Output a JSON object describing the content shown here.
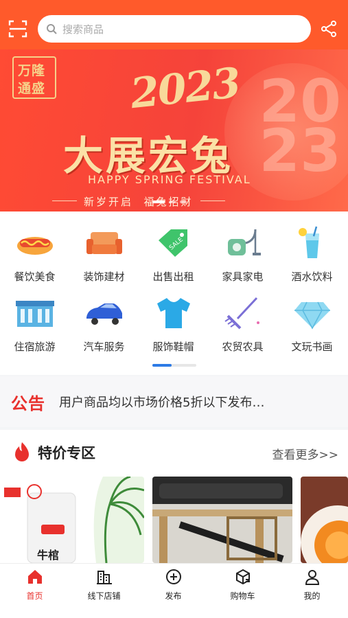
{
  "header": {
    "search_placeholder": "搜索商品",
    "scan_icon": "scan-icon",
    "share_icon": "share-icon",
    "bar_color": "#ff5a2b"
  },
  "banner": {
    "logo_line1": "万隆",
    "logo_line2": "通盛",
    "year": "2023",
    "headline": "大展宏兔",
    "english": "HAPPY SPRING FESTIVAL",
    "subline": "新岁开启  福兔招财",
    "deco_digits": "20\n23",
    "slide_count": 3,
    "active_slide": 1
  },
  "categories": [
    {
      "label": "餐饮美食",
      "icon": "hotdog-icon"
    },
    {
      "label": "装饰建材",
      "icon": "sofa-icon"
    },
    {
      "label": "出售出租",
      "icon": "sale-tag-icon"
    },
    {
      "label": "家具家电",
      "icon": "vacuum-icon"
    },
    {
      "label": "酒水饮料",
      "icon": "drink-icon"
    },
    {
      "label": "住宿旅游",
      "icon": "hotel-icon"
    },
    {
      "label": "汽车服务",
      "icon": "car-icon"
    },
    {
      "label": "服饰鞋帽",
      "icon": "shirt-icon"
    },
    {
      "label": "农贸农具",
      "icon": "rake-icon"
    },
    {
      "label": "文玩书画",
      "icon": "diamond-icon"
    }
  ],
  "notice": {
    "tag": "公告",
    "text": "用户商品均以市场价格5折以下发布…"
  },
  "special": {
    "title": "特价专区",
    "more": "查看更多>>",
    "products": [
      {
        "name": "milk-product-image",
        "visible_text": "牛棺"
      },
      {
        "name": "guzheng-product-image"
      },
      {
        "name": "food-product-image"
      }
    ]
  },
  "tabbar": {
    "items": [
      {
        "label": "首页",
        "icon": "home-icon",
        "active": true
      },
      {
        "label": "线下店铺",
        "icon": "store-icon",
        "active": false
      },
      {
        "label": "发布",
        "icon": "plus-circle-icon",
        "active": false
      },
      {
        "label": "购物车",
        "icon": "cart-box-icon",
        "active": false
      },
      {
        "label": "我的",
        "icon": "user-icon",
        "active": false
      }
    ],
    "active_color": "#e8312d"
  }
}
